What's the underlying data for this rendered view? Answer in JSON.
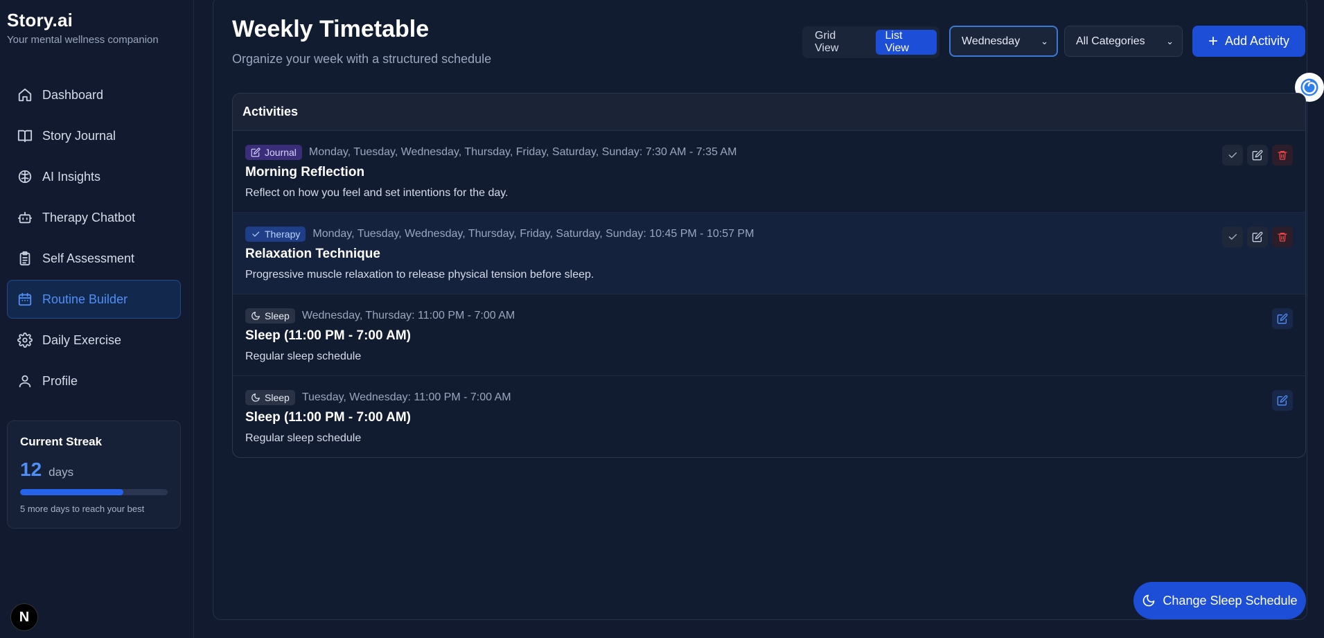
{
  "brand": {
    "title": "Story.ai",
    "subtitle": "Your mental wellness companion"
  },
  "sidebar": {
    "items": [
      {
        "label": "Dashboard",
        "icon": "home-icon"
      },
      {
        "label": "Story Journal",
        "icon": "book-icon"
      },
      {
        "label": "AI Insights",
        "icon": "brain-icon"
      },
      {
        "label": "Therapy Chatbot",
        "icon": "bot-icon"
      },
      {
        "label": "Self Assessment",
        "icon": "clipboard-icon"
      },
      {
        "label": "Routine Builder",
        "icon": "calendar-icon",
        "active": true
      },
      {
        "label": "Daily Exercise",
        "icon": "gear-icon"
      },
      {
        "label": "Profile",
        "icon": "user-icon"
      }
    ]
  },
  "streak": {
    "title": "Current Streak",
    "count": "12",
    "unit": "days",
    "progress_fraction": 0.7,
    "note": "5 more days to reach your best"
  },
  "header": {
    "title": "Weekly Timetable",
    "subtitle": "Organize your week with a structured schedule"
  },
  "toolbar": {
    "grid_view_label": "Grid View",
    "list_view_label": "List View",
    "view_mode": "List View",
    "day_select": "Wednesday",
    "category_select": "All Categories",
    "add_label": "Add Activity"
  },
  "activities": {
    "heading": "Activities",
    "items": [
      {
        "tag": "Journal",
        "tag_icon": "pencil-square-icon",
        "schedule": "Monday, Tuesday, Wednesday, Thursday, Friday, Saturday, Sunday: 7:30 AM - 7:35 AM",
        "title": "Morning Reflection",
        "description": "Reflect on how you feel and set intentions for the day."
      },
      {
        "tag": "Therapy",
        "tag_icon": "check-icon",
        "schedule": "Monday, Tuesday, Wednesday, Thursday, Friday, Saturday, Sunday: 10:45 PM - 10:57 PM",
        "title": "Relaxation Technique",
        "description": "Progressive muscle relaxation to release physical tension before sleep."
      },
      {
        "tag": "Sleep",
        "tag_icon": "moon-icon",
        "schedule": "Wednesday, Thursday: 11:00 PM - 7:00 AM",
        "title": "Sleep (11:00 PM - 7:00 AM)",
        "description": "Regular sleep schedule"
      },
      {
        "tag": "Sleep",
        "tag_icon": "moon-icon",
        "schedule": "Tuesday, Wednesday: 11:00 PM - 7:00 AM",
        "title": "Sleep (11:00 PM - 7:00 AM)",
        "description": "Regular sleep schedule"
      }
    ]
  },
  "sleep_button_label": "Change Sleep Schedule",
  "next_badge": "N",
  "colors": {
    "accent": "#1d4ed8",
    "background": "#111a2e",
    "danger": "#ef4444"
  }
}
